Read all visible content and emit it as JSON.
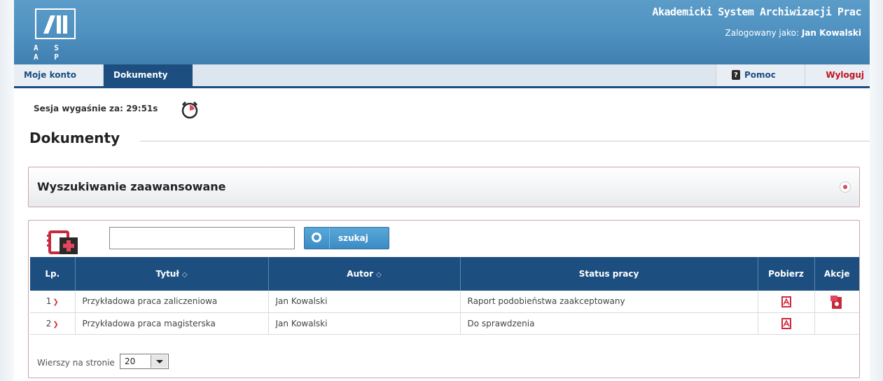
{
  "header": {
    "logo_text": "A S A P",
    "app_title": "Akademicki System Archiwizacji Prac",
    "logged_as_label": "Zalogowany jako:",
    "user_name": "Jan Kowalski"
  },
  "tabs": {
    "moje_konto": "Moje konto",
    "dokumenty": "Dokumenty",
    "pomoc": "Pomoc",
    "wyloguj": "Wyloguj"
  },
  "session": {
    "label": "Sesja wygaśnie za: 29:51s"
  },
  "page_title": "Dokumenty",
  "advanced_search": {
    "title": "Wyszukiwanie zaawansowane"
  },
  "search": {
    "value": "",
    "button_label": "szukaj"
  },
  "table": {
    "columns": {
      "lp": "Lp.",
      "title": "Tytuł",
      "author": "Autor",
      "status": "Status pracy",
      "download": "Pobierz",
      "actions": "Akcje"
    },
    "sort_icon": "◇",
    "rows": [
      {
        "lp": "1",
        "title": "Przykładowa praca zaliczeniowa",
        "author": "Jan Kowalski",
        "status": "Raport podobieństwa zaakceptowany"
      },
      {
        "lp": "2",
        "title": "Przykładowa praca magisterska",
        "author": "Jan Kowalski",
        "status": "Do sprawdzenia"
      }
    ]
  },
  "pagination": {
    "rows_label": "Wierszy na stronie",
    "rows_value": "20"
  },
  "colors": {
    "header_blue": "#4f91c0",
    "nav_dark_blue": "#1c4e80",
    "accent_red": "#c1121f"
  }
}
